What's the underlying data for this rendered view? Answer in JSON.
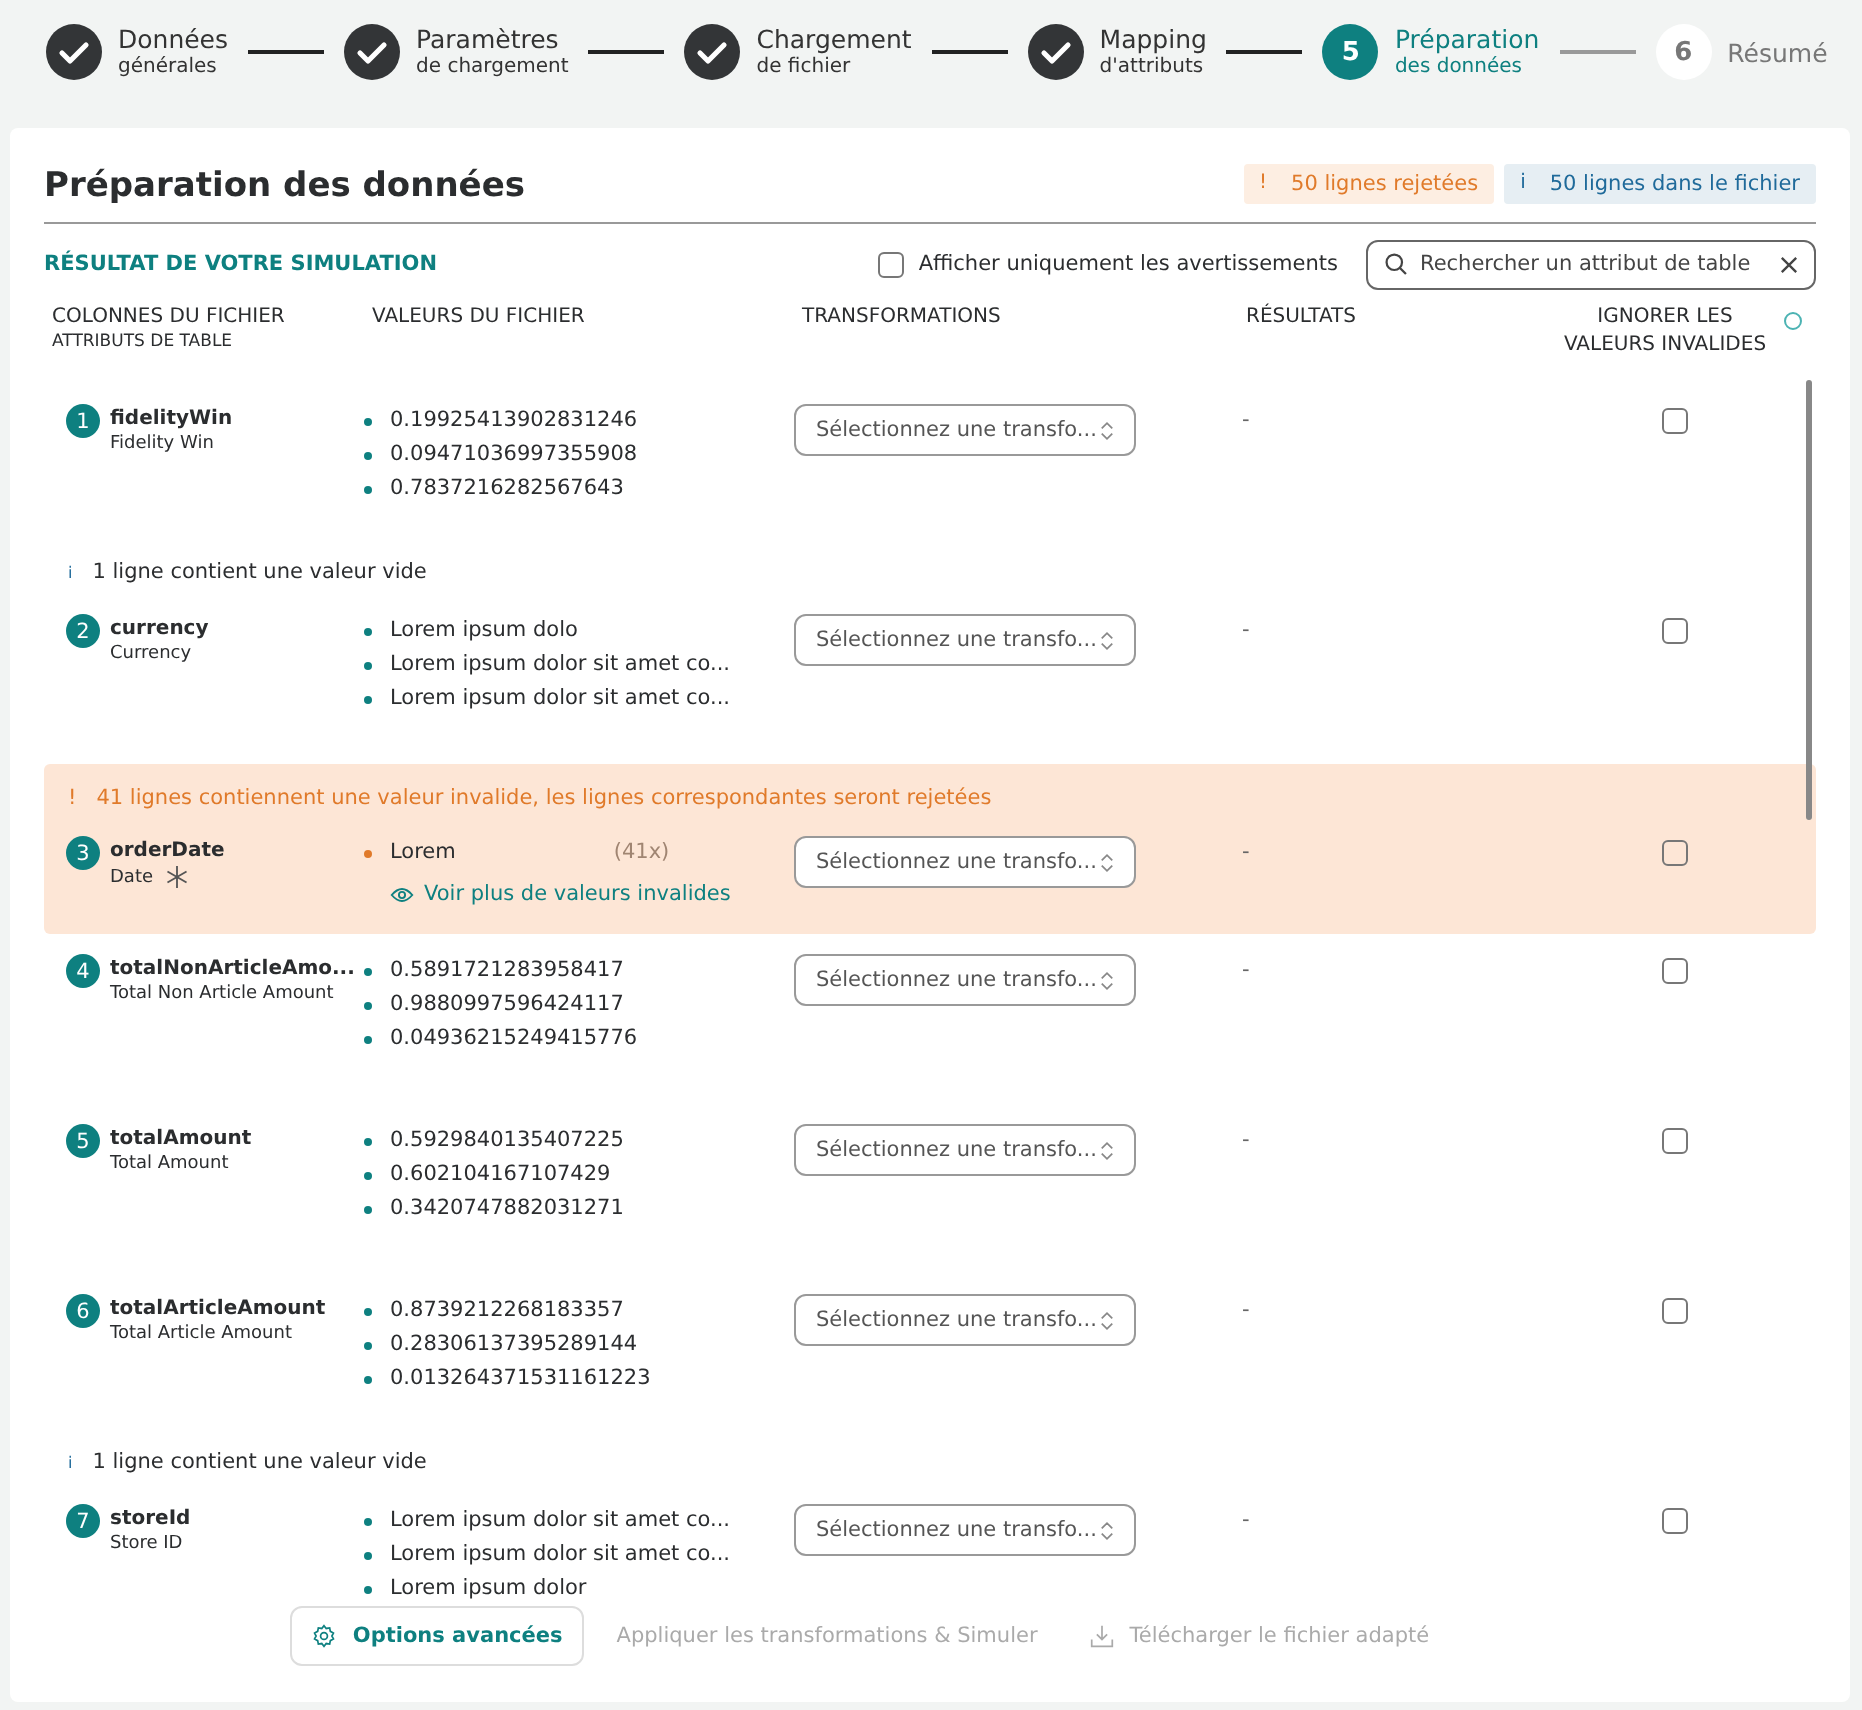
{
  "steps": [
    {
      "title": "Données",
      "subtitle": "générales",
      "completed": true,
      "selected": false
    },
    {
      "title": "Paramètres",
      "subtitle": "de chargement",
      "completed": true,
      "selected": false
    },
    {
      "title": "Chargement",
      "subtitle": "de fichier",
      "completed": true,
      "selected": false
    },
    {
      "title": "Mapping",
      "subtitle": "d'attributs",
      "completed": true,
      "selected": false
    },
    {
      "number": "5",
      "title": "Préparation",
      "subtitle": "des données",
      "completed": false,
      "selected": true
    },
    {
      "number": "6",
      "title": "Résumé",
      "completed": false,
      "selected": false
    }
  ],
  "header": {
    "title": "Préparation des données",
    "badges": [
      {
        "kind": "warning",
        "icon": "!",
        "text": "50 lignes rejetées"
      },
      {
        "kind": "info",
        "icon": "i",
        "text": "50 lignes dans le fichier"
      }
    ]
  },
  "section_label": "RÉSULTAT DE VOTRE SIMULATION",
  "filter": {
    "label": "Afficher uniquement les avertissements",
    "checked": false
  },
  "search": {
    "placeholder": "Rechercher un attribut de table"
  },
  "columns": [
    {
      "label": "COLONNES DU FICHIER",
      "sublabel": "ATTRIBUTS DE TABLE"
    },
    {
      "label": "VALEURS DU FICHIER"
    },
    {
      "label": "TRANSFORMATIONS"
    },
    {
      "label": "RÉSULTATS"
    },
    {
      "label": "IGNORER LES VALEURS INVALIDES",
      "info": true
    }
  ],
  "rows": [
    {
      "number": "1",
      "name": "fidelityWin",
      "label": "Fidelity Win",
      "required": false,
      "values": [
        {
          "text": "0.19925413902831246",
          "invalid": false
        },
        {
          "text": "0.09471036997355908",
          "invalid": false
        },
        {
          "text": "0.7837216282567643",
          "invalid": false
        }
      ],
      "transformation": "Sélectionnez une transfo...",
      "result": "-",
      "ignore": false
    },
    {
      "number": "2",
      "name": "currency",
      "label": "Currency",
      "required": false,
      "notice": {
        "kind": "info",
        "icon": "i",
        "text": "1 ligne contient une valeur vide"
      },
      "values": [
        {
          "text": "Lorem ipsum dolo",
          "invalid": false
        },
        {
          "text": "Lorem ipsum dolor sit amet co...",
          "invalid": false
        },
        {
          "text": "Lorem ipsum dolor sit amet co...",
          "invalid": false
        }
      ],
      "transformation": "Sélectionnez une transfo...",
      "result": "-",
      "ignore": false
    },
    {
      "number": "3",
      "name": "orderDate",
      "label": "Date",
      "required": true,
      "notice": {
        "kind": "warning",
        "icon": "!",
        "text": "41 lignes contiennent une valeur invalide, les lignes correspondantes seront rejetées"
      },
      "values": [
        {
          "text": "Lorem",
          "invalid": true,
          "count": "(41x)"
        }
      ],
      "more_link": "Voir plus de valeurs invalides",
      "transformation": "Sélectionnez une transfo...",
      "result": "-",
      "ignore": false
    },
    {
      "number": "4",
      "name": "totalNonArticleAmo...",
      "label": "Total Non Article Amount",
      "required": false,
      "values": [
        {
          "text": "0.5891721283958417",
          "invalid": false
        },
        {
          "text": "0.9880997596424117",
          "invalid": false
        },
        {
          "text": "0.04936215249415776",
          "invalid": false
        }
      ],
      "transformation": "Sélectionnez une transfo...",
      "result": "-",
      "ignore": false
    },
    {
      "number": "5",
      "name": "totalAmount",
      "label": "Total Amount",
      "required": false,
      "values": [
        {
          "text": "0.5929840135407225",
          "invalid": false
        },
        {
          "text": "0.602104167107429",
          "invalid": false
        },
        {
          "text": "0.3420747882031271",
          "invalid": false
        }
      ],
      "transformation": "Sélectionnez une transfo...",
      "result": "-",
      "ignore": false
    },
    {
      "number": "6",
      "name": "totalArticleAmount",
      "label": "Total Article Amount",
      "required": false,
      "values": [
        {
          "text": "0.8739212268183357",
          "invalid": false
        },
        {
          "text": "0.28306137395289144",
          "invalid": false
        },
        {
          "text": "0.013264371531161223",
          "invalid": false
        }
      ],
      "transformation": "Sélectionnez une transfo...",
      "result": "-",
      "ignore": false
    },
    {
      "number": "7",
      "name": "storeId",
      "label": "Store ID",
      "required": false,
      "notice": {
        "kind": "info",
        "icon": "i",
        "text": "1 ligne contient une valeur vide"
      },
      "values": [
        {
          "text": "Lorem ipsum dolor sit amet co...",
          "invalid": false
        },
        {
          "text": "Lorem ipsum dolor sit amet co...",
          "invalid": false
        },
        {
          "text": "Lorem ipsum dolor",
          "invalid": false
        }
      ],
      "transformation": "Sélectionnez une transfo...",
      "result": "-",
      "ignore": false
    }
  ],
  "footer_buttons": [
    {
      "kind": "options",
      "label": "Options avancées",
      "disabled": false
    },
    {
      "kind": "apply",
      "label": "Appliquer les transformations & Simuler",
      "disabled": true
    },
    {
      "kind": "download",
      "label": "Télécharger le fichier adapté",
      "disabled": true
    }
  ]
}
